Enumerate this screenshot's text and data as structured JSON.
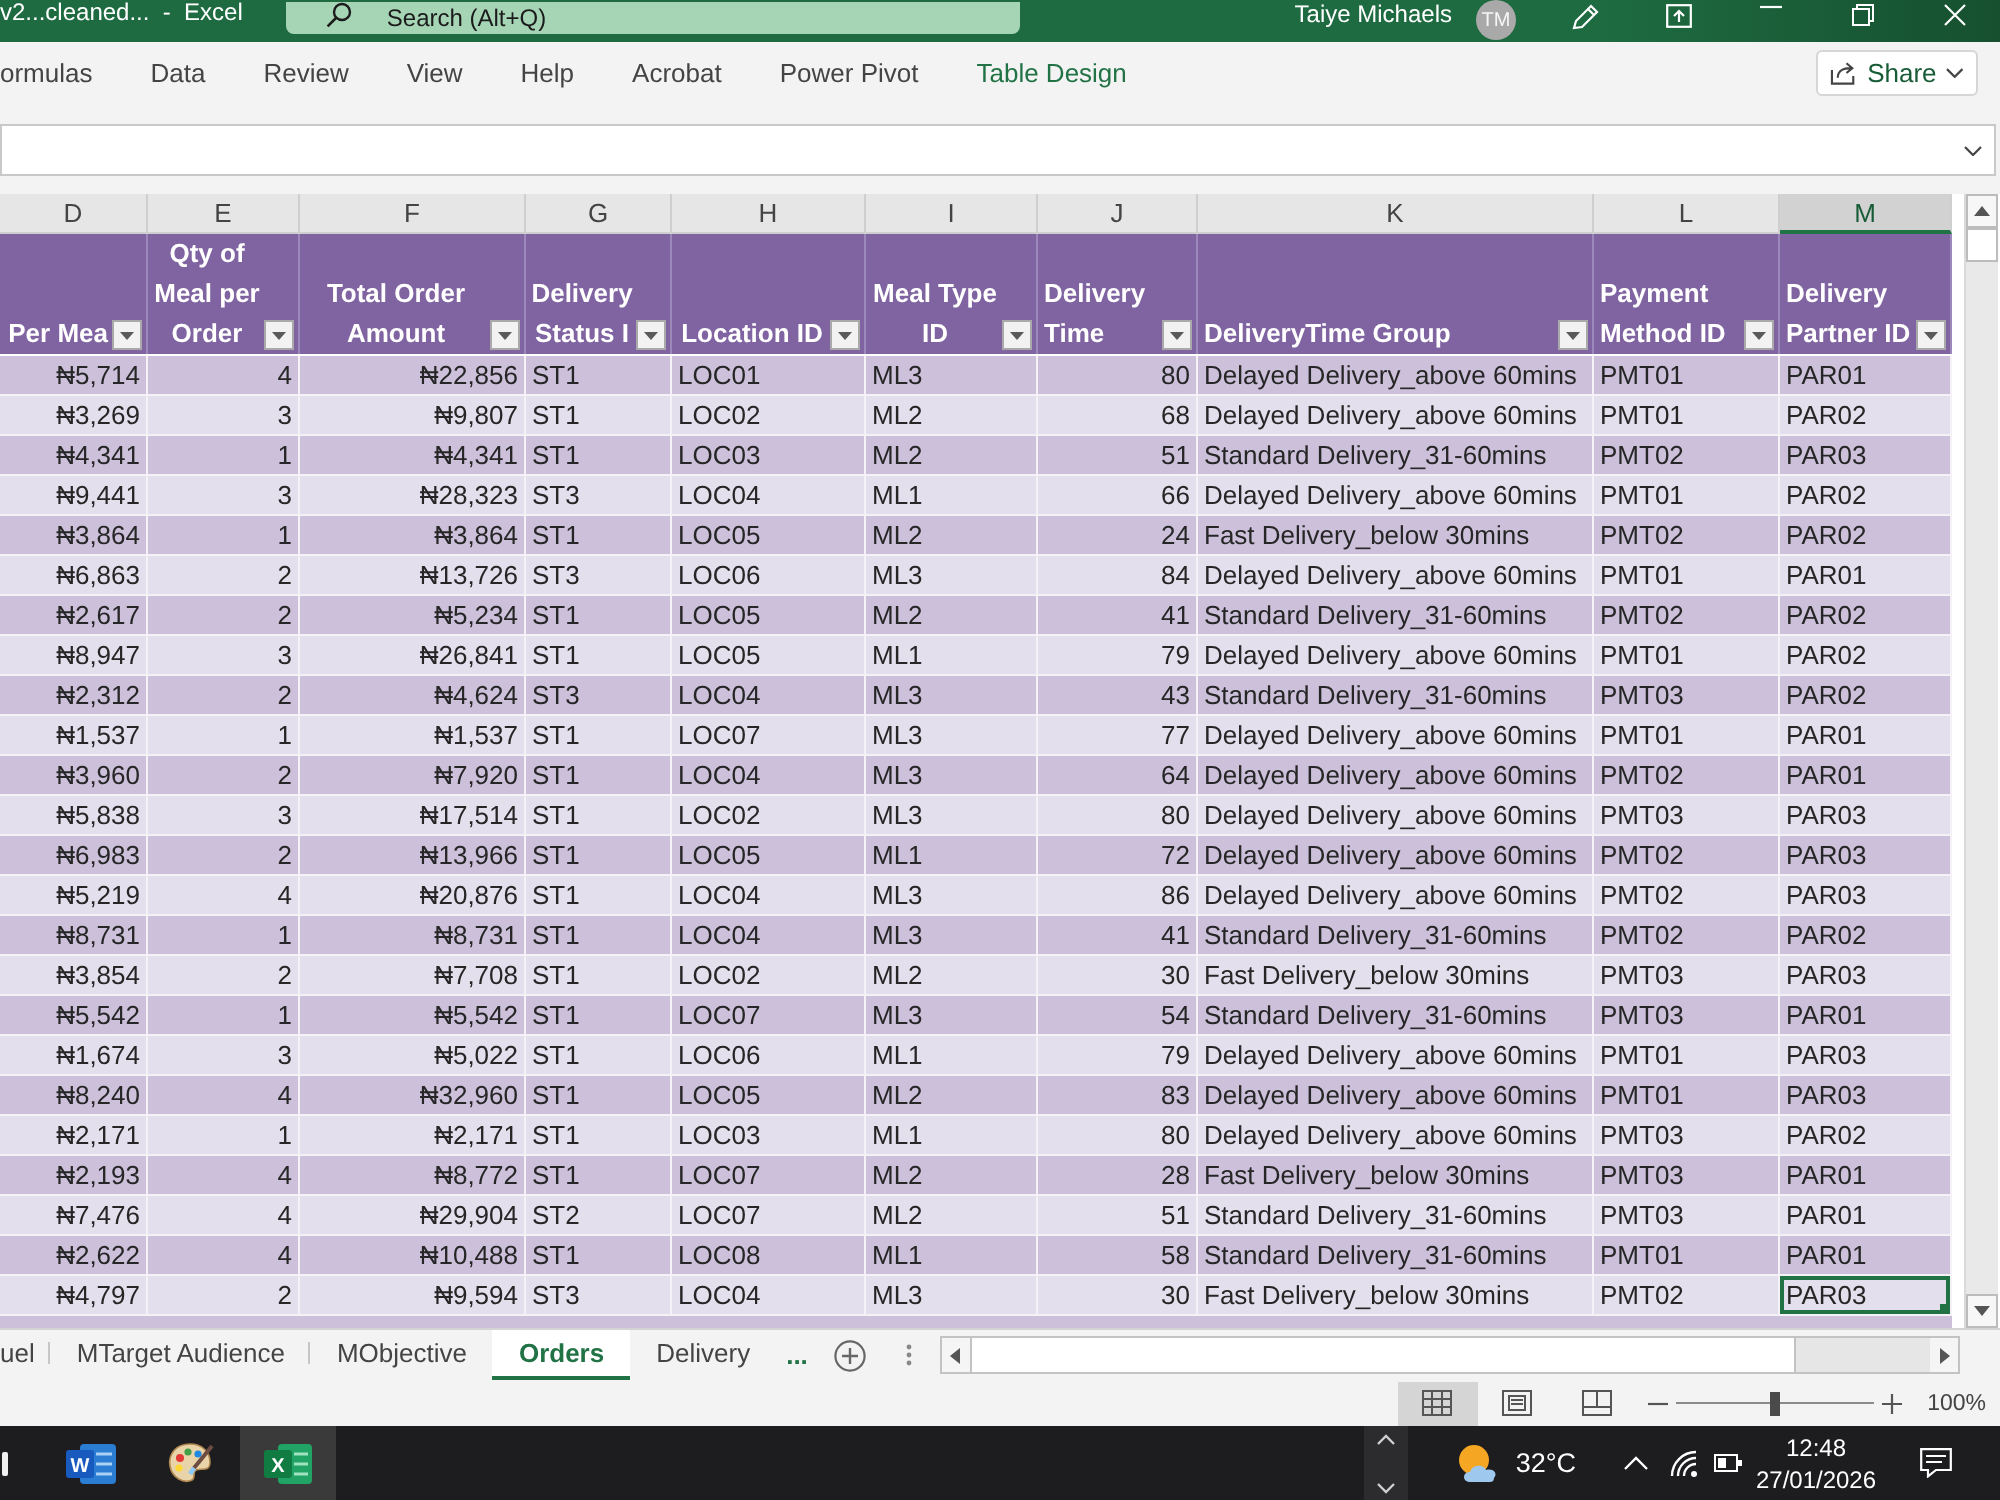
{
  "window": {
    "title": "v2...cleaned...  -  Excel",
    "search": {
      "placeholder": "Search (Alt+Q)"
    },
    "user": {
      "name": "Taiye Michaels",
      "initials": "TM"
    }
  },
  "ribbon": {
    "tabs": [
      {
        "label": "ormulas",
        "selected": false,
        "contextual": false
      },
      {
        "label": "Data",
        "selected": false,
        "contextual": false
      },
      {
        "label": "Review",
        "selected": false,
        "contextual": false
      },
      {
        "label": "View",
        "selected": false,
        "contextual": false
      },
      {
        "label": "Help",
        "selected": false,
        "contextual": false
      },
      {
        "label": "Acrobat",
        "selected": false,
        "contextual": false
      },
      {
        "label": "Power Pivot",
        "selected": false,
        "contextual": false
      },
      {
        "label": "Table Design",
        "selected": false,
        "contextual": true
      }
    ],
    "share_button": "Share"
  },
  "sheet": {
    "columns": [
      {
        "letter": "D",
        "selected": false,
        "heading": "Per Mea"
      },
      {
        "letter": "E",
        "selected": false,
        "heading": "Qty of\nMeal per\nOrder"
      },
      {
        "letter": "F",
        "selected": false,
        "heading": "Total Order\nAmount"
      },
      {
        "letter": "G",
        "selected": false,
        "heading": "Delivery\nStatus I"
      },
      {
        "letter": "H",
        "selected": false,
        "heading": "Location ID"
      },
      {
        "letter": "I",
        "selected": false,
        "heading": "Meal Type\nID"
      },
      {
        "letter": "J",
        "selected": false,
        "heading": "Delivery\nTime"
      },
      {
        "letter": "K",
        "selected": false,
        "heading": "DeliveryTime Group"
      },
      {
        "letter": "L",
        "selected": false,
        "heading": "Payment\nMethod ID"
      },
      {
        "letter": "M",
        "selected": true,
        "heading": "Delivery\nPartner ID"
      }
    ],
    "rows": [
      {
        "selected": false,
        "cells": [
          "₦5,714",
          "4",
          "₦22,856",
          "ST1",
          "LOC01",
          "ML3",
          "80",
          "Delayed Delivery_above 60mins",
          "PMT01",
          "PAR01"
        ]
      },
      {
        "selected": false,
        "cells": [
          "₦3,269",
          "3",
          "₦9,807",
          "ST1",
          "LOC02",
          "ML2",
          "68",
          "Delayed Delivery_above 60mins",
          "PMT01",
          "PAR02"
        ]
      },
      {
        "selected": false,
        "cells": [
          "₦4,341",
          "1",
          "₦4,341",
          "ST1",
          "LOC03",
          "ML2",
          "51",
          "Standard Delivery_31-60mins",
          "PMT02",
          "PAR03"
        ]
      },
      {
        "selected": false,
        "cells": [
          "₦9,441",
          "3",
          "₦28,323",
          "ST3",
          "LOC04",
          "ML1",
          "66",
          "Delayed Delivery_above 60mins",
          "PMT01",
          "PAR02"
        ]
      },
      {
        "selected": false,
        "cells": [
          "₦3,864",
          "1",
          "₦3,864",
          "ST1",
          "LOC05",
          "ML2",
          "24",
          "Fast Delivery_below 30mins",
          "PMT02",
          "PAR02"
        ]
      },
      {
        "selected": false,
        "cells": [
          "₦6,863",
          "2",
          "₦13,726",
          "ST3",
          "LOC06",
          "ML3",
          "84",
          "Delayed Delivery_above 60mins",
          "PMT01",
          "PAR01"
        ]
      },
      {
        "selected": false,
        "cells": [
          "₦2,617",
          "2",
          "₦5,234",
          "ST1",
          "LOC05",
          "ML2",
          "41",
          "Standard Delivery_31-60mins",
          "PMT02",
          "PAR02"
        ]
      },
      {
        "selected": false,
        "cells": [
          "₦8,947",
          "3",
          "₦26,841",
          "ST1",
          "LOC05",
          "ML1",
          "79",
          "Delayed Delivery_above 60mins",
          "PMT01",
          "PAR02"
        ]
      },
      {
        "selected": false,
        "cells": [
          "₦2,312",
          "2",
          "₦4,624",
          "ST3",
          "LOC04",
          "ML3",
          "43",
          "Standard Delivery_31-60mins",
          "PMT03",
          "PAR02"
        ]
      },
      {
        "selected": false,
        "cells": [
          "₦1,537",
          "1",
          "₦1,537",
          "ST1",
          "LOC07",
          "ML3",
          "77",
          "Delayed Delivery_above 60mins",
          "PMT01",
          "PAR01"
        ]
      },
      {
        "selected": false,
        "cells": [
          "₦3,960",
          "2",
          "₦7,920",
          "ST1",
          "LOC04",
          "ML3",
          "64",
          "Delayed Delivery_above 60mins",
          "PMT02",
          "PAR01"
        ]
      },
      {
        "selected": false,
        "cells": [
          "₦5,838",
          "3",
          "₦17,514",
          "ST1",
          "LOC02",
          "ML3",
          "80",
          "Delayed Delivery_above 60mins",
          "PMT03",
          "PAR03"
        ]
      },
      {
        "selected": false,
        "cells": [
          "₦6,983",
          "2",
          "₦13,966",
          "ST1",
          "LOC05",
          "ML1",
          "72",
          "Delayed Delivery_above 60mins",
          "PMT02",
          "PAR03"
        ]
      },
      {
        "selected": false,
        "cells": [
          "₦5,219",
          "4",
          "₦20,876",
          "ST1",
          "LOC04",
          "ML3",
          "86",
          "Delayed Delivery_above 60mins",
          "PMT02",
          "PAR03"
        ]
      },
      {
        "selected": false,
        "cells": [
          "₦8,731",
          "1",
          "₦8,731",
          "ST1",
          "LOC04",
          "ML3",
          "41",
          "Standard Delivery_31-60mins",
          "PMT02",
          "PAR02"
        ]
      },
      {
        "selected": false,
        "cells": [
          "₦3,854",
          "2",
          "₦7,708",
          "ST1",
          "LOC02",
          "ML2",
          "30",
          "Fast Delivery_below 30mins",
          "PMT03",
          "PAR03"
        ]
      },
      {
        "selected": false,
        "cells": [
          "₦5,542",
          "1",
          "₦5,542",
          "ST1",
          "LOC07",
          "ML3",
          "54",
          "Standard Delivery_31-60mins",
          "PMT03",
          "PAR01"
        ]
      },
      {
        "selected": false,
        "cells": [
          "₦1,674",
          "3",
          "₦5,022",
          "ST1",
          "LOC06",
          "ML1",
          "79",
          "Delayed Delivery_above 60mins",
          "PMT01",
          "PAR03"
        ]
      },
      {
        "selected": false,
        "cells": [
          "₦8,240",
          "4",
          "₦32,960",
          "ST1",
          "LOC05",
          "ML2",
          "83",
          "Delayed Delivery_above 60mins",
          "PMT01",
          "PAR03"
        ]
      },
      {
        "selected": false,
        "cells": [
          "₦2,171",
          "1",
          "₦2,171",
          "ST1",
          "LOC03",
          "ML1",
          "80",
          "Delayed Delivery_above 60mins",
          "PMT03",
          "PAR02"
        ]
      },
      {
        "selected": false,
        "cells": [
          "₦2,193",
          "4",
          "₦8,772",
          "ST1",
          "LOC07",
          "ML2",
          "28",
          "Fast Delivery_below 30mins",
          "PMT03",
          "PAR01"
        ]
      },
      {
        "selected": false,
        "cells": [
          "₦7,476",
          "4",
          "₦29,904",
          "ST2",
          "LOC07",
          "ML2",
          "51",
          "Standard Delivery_31-60mins",
          "PMT03",
          "PAR01"
        ]
      },
      {
        "selected": false,
        "cells": [
          "₦2,622",
          "4",
          "₦10,488",
          "ST1",
          "LOC08",
          "ML1",
          "58",
          "Standard Delivery_31-60mins",
          "PMT01",
          "PAR01"
        ]
      },
      {
        "selected": true,
        "cells": [
          "₦4,797",
          "2",
          "₦9,594",
          "ST3",
          "LOC04",
          "ML3",
          "30",
          "Fast Delivery_below 30mins",
          "PMT02",
          "PAR03"
        ]
      }
    ]
  },
  "sheet_tabs": {
    "tabs": [
      {
        "label": "uel",
        "selected": false
      },
      {
        "label": "MTarget Audience",
        "selected": false
      },
      {
        "label": "MObjective",
        "selected": false
      },
      {
        "label": "Orders",
        "selected": true
      },
      {
        "label": "Delivery",
        "selected": false
      }
    ],
    "more_button": "..."
  },
  "status_bar": {
    "views": [
      {
        "kind": "normal",
        "selected": true
      },
      {
        "kind": "page_layout",
        "selected": false
      },
      {
        "kind": "page_break",
        "selected": false
      }
    ],
    "zoom": {
      "level": 0.5,
      "label": "100%"
    }
  },
  "taskbar": {
    "apps": [
      {
        "kind": "document",
        "letter": "W",
        "selected": false
      },
      {
        "kind": "palette",
        "selected": false
      },
      {
        "kind": "spreadsheet",
        "letter": "X",
        "selected": true
      }
    ],
    "temperature": "32°C",
    "time": "12:48",
    "date": "27/01/2026"
  }
}
